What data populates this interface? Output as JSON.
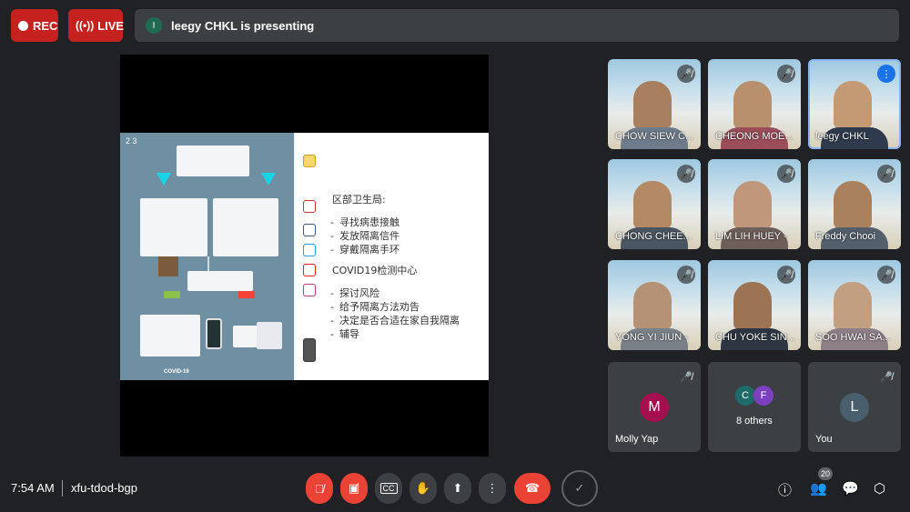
{
  "header": {
    "rec_label": "REC",
    "live_label": "LIVE",
    "presenter_initial": "I",
    "presenting_text": "leegy CHKL is presenting"
  },
  "slide": {
    "heading_1": "区部卫生局:",
    "list_1": [
      "寻找病患接触",
      "发放隔离信件",
      "穿戴隔离手环"
    ],
    "heading_2": "COVID19检测中心",
    "list_2": [
      "探讨风险",
      "给予隔离方法劝告",
      "决定是否合适在家自我隔离",
      "辅导"
    ],
    "page_number": "2 3",
    "poster_brand": "COVID-19"
  },
  "participants": [
    {
      "name": "CHOW SIEW C...",
      "muted": true
    },
    {
      "name": "CHEONG MOE...",
      "muted": true
    },
    {
      "name": "leegy CHKL",
      "muted": false,
      "speaking": true
    },
    {
      "name": "CHONG CHEE...",
      "muted": true
    },
    {
      "name": "LIM LIH HUEY -",
      "muted": true
    },
    {
      "name": "Freddy Chooi",
      "muted": true
    },
    {
      "name": "YONG YI JIUN -",
      "muted": true
    },
    {
      "name": "CHU YOKE SIN...",
      "muted": true
    },
    {
      "name": "SOO HWAI SA...",
      "muted": true
    }
  ],
  "tile_molly": {
    "name": "Molly Yap",
    "initial": "M",
    "color": "#a50e4f"
  },
  "tile_others": {
    "label": "8 others",
    "initials": [
      "C",
      "F"
    ],
    "colors": [
      "#1e6b6b",
      "#7b3fbf"
    ]
  },
  "tile_you": {
    "name": "You",
    "initial": "L",
    "color": "#4a5f6e"
  },
  "footer": {
    "time": "7:54 AM",
    "meeting_code": "xfu-tdod-bgp",
    "participant_count": "20"
  },
  "colors": {
    "accent_red": "#ea4335",
    "speaking_blue": "#1a73e8",
    "background": "#202124"
  }
}
